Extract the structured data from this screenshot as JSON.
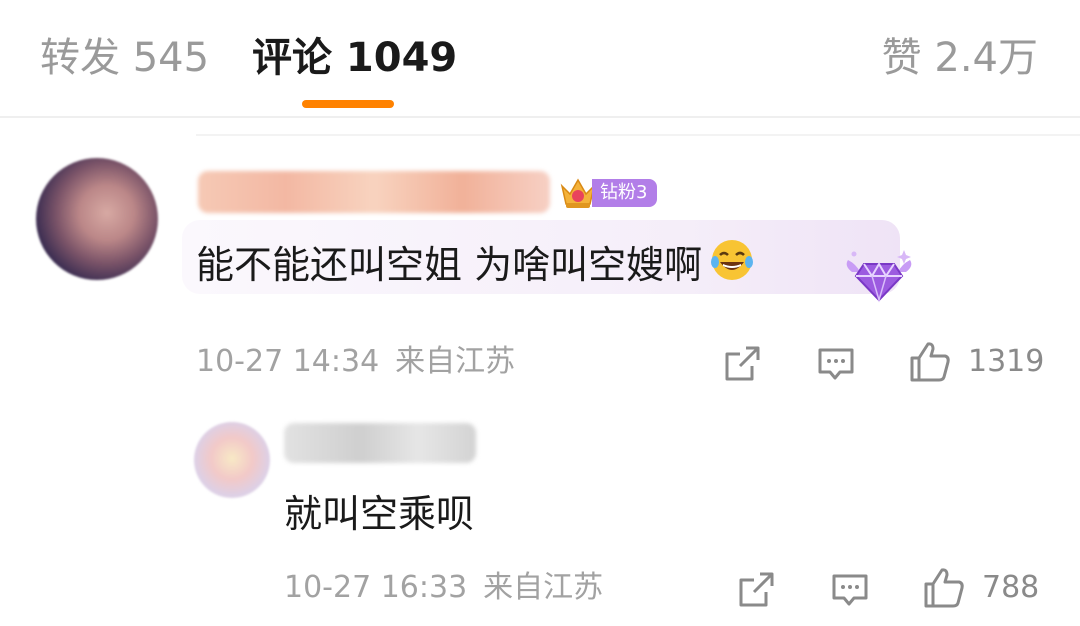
{
  "tabs": {
    "repost_label": "转发 545",
    "comments_label": "评论 1049",
    "likes_label": "赞 2.4万"
  },
  "colors": {
    "accent": "#ff8200",
    "badge": "#b27ee8",
    "meta_text": "#a2a2a2"
  },
  "comment": {
    "text": "能不能还叫空姐 为啥叫空嫂啊",
    "emoji": "laugh-cry-emoji",
    "fan_badge": "钻粉3",
    "date": "10-27 14:34",
    "location": "来自江苏",
    "likes": "1319",
    "icons": [
      "share-icon",
      "comment-icon",
      "like-icon"
    ]
  },
  "reply": {
    "text": "就叫空乘呗",
    "date": "10-27 16:33",
    "location": "来自江苏",
    "likes": "788",
    "icons": [
      "share-icon",
      "comment-icon",
      "like-icon"
    ]
  }
}
